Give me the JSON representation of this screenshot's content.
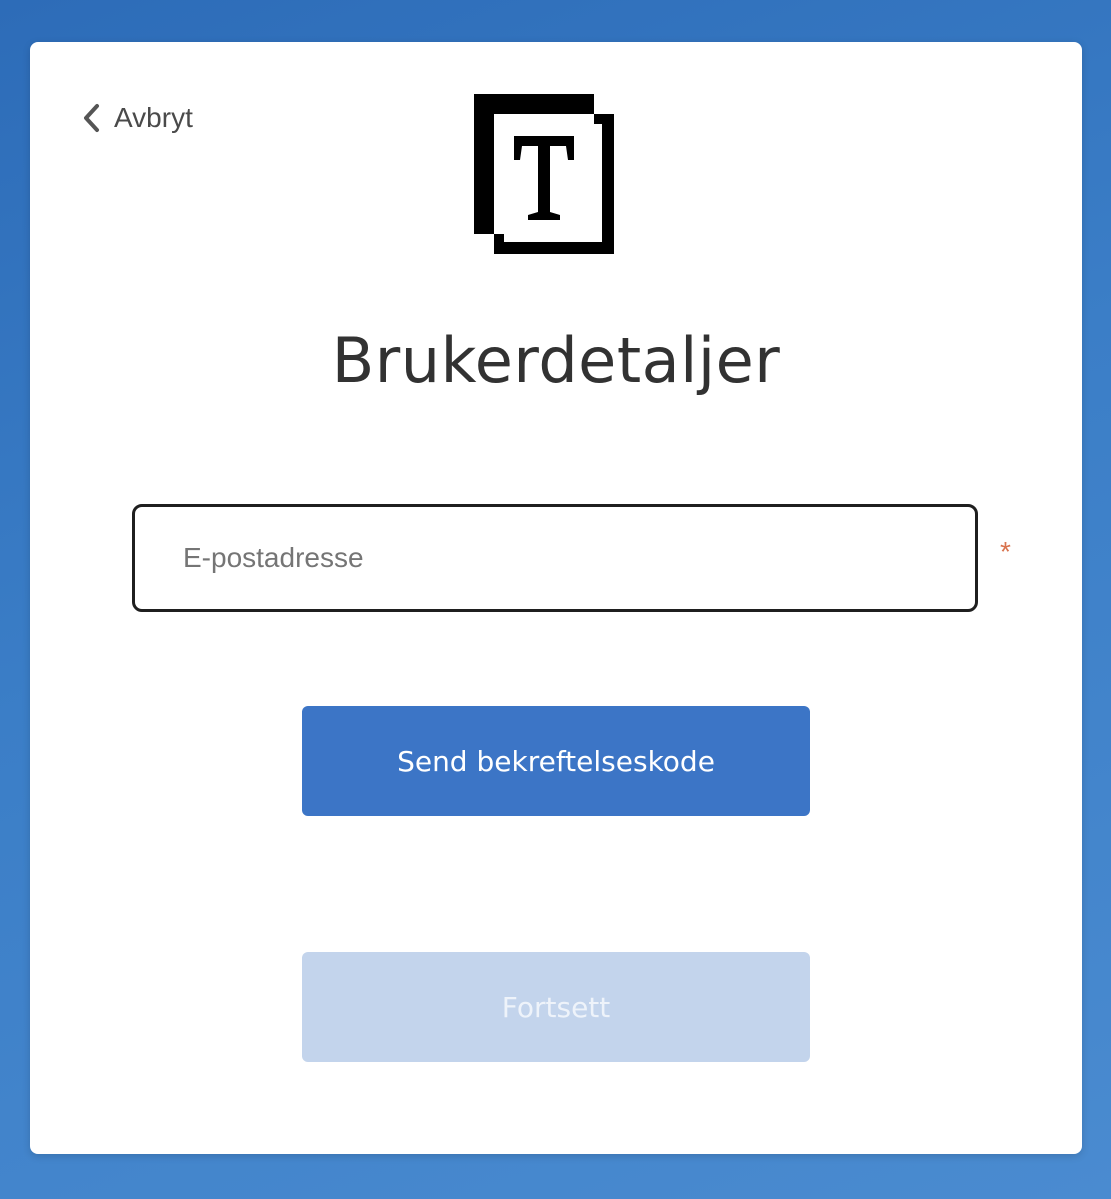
{
  "header": {
    "cancel_label": "Avbryt",
    "logo_icon": "t-logo-icon"
  },
  "main": {
    "title": "Brukerdetaljer",
    "email": {
      "placeholder": "E-postadresse",
      "value": "",
      "required_marker": "*"
    },
    "send_code_label": "Send bekreftelseskode",
    "continue_label": "Fortsett"
  },
  "colors": {
    "background": "#3f7fc3",
    "primary_button": "#3c75c6",
    "disabled_button": "#c3d4ec",
    "required_marker": "#d9734e"
  }
}
